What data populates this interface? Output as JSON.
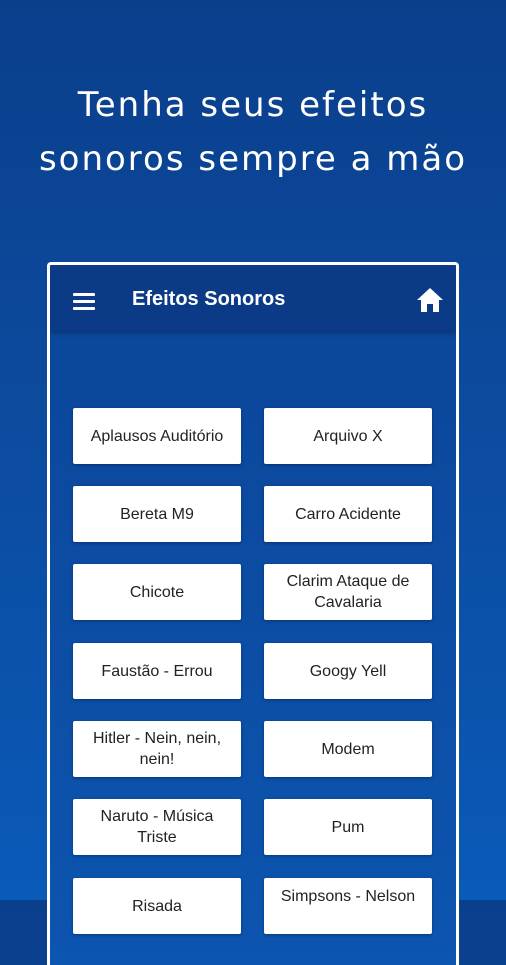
{
  "headline": {
    "line1": "Tenha seus efeitos",
    "line2": "sonoros sempre a mão"
  },
  "appbar": {
    "title": "Efeitos Sonoros",
    "menu_icon": "menu-icon",
    "home_icon": "home-icon"
  },
  "sounds": [
    "Aplausos Auditório",
    "Arquivo X",
    "Bereta M9",
    "Carro Acidente",
    "Chicote",
    "Clarim Ataque de Cavalaria",
    "Faustão - Errou",
    "Googy Yell",
    "Hitler - Nein, nein, nein!",
    "Modem",
    "Naruto - Música Triste",
    "Pum",
    "Risada",
    "Simpsons - Nelson"
  ],
  "colors": {
    "background": "#0a4a9e",
    "appbar": "#0b3b87",
    "button": "#ffffff"
  }
}
